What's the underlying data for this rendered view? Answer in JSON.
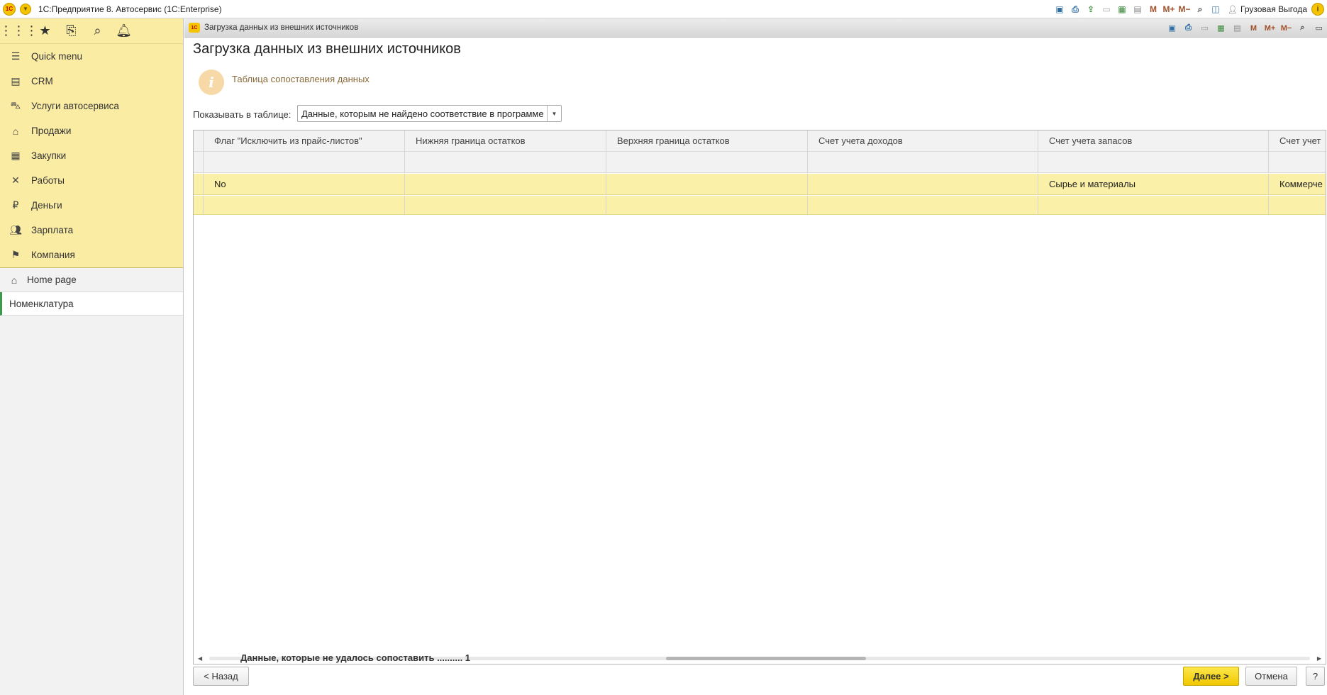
{
  "app": {
    "title": "1С:Предприятие 8. Автосервис  (1С:Enterprise)",
    "user": "Грузовая Выгода"
  },
  "toolbar_icons": [
    "save-icon",
    "print-icon",
    "upload-icon",
    "document-icon",
    "table-icon",
    "calendar-icon",
    "M",
    "M+",
    "M-",
    "zoom-icon",
    "panel-icon"
  ],
  "sidebar": {
    "tools": [
      "apps-grid-icon",
      "star-icon",
      "history-icon",
      "search-icon",
      "bell-icon"
    ],
    "sections": [
      {
        "label": "Quick menu",
        "icon": "menu-icon"
      },
      {
        "label": "CRM",
        "icon": "crm-icon"
      },
      {
        "label": "Услуги автосервиса",
        "icon": "car-icon"
      },
      {
        "label": "Продажи",
        "icon": "shop-icon"
      },
      {
        "label": "Закупки",
        "icon": "cart-icon"
      },
      {
        "label": "Работы",
        "icon": "tools-icon"
      },
      {
        "label": "Деньги",
        "icon": "ruble-icon"
      },
      {
        "label": "Зарплата",
        "icon": "people-icon"
      },
      {
        "label": "Компания",
        "icon": "flag-icon"
      }
    ],
    "home": "Home page",
    "open_item": "Номенклатура"
  },
  "window": {
    "tab_title": "Загрузка данных из внешних источников",
    "page_title": "Загрузка данных из внешних источников",
    "info_text": "Таблица сопоставления данных",
    "filter_label": "Показывать в таблице:",
    "filter_value": "Данные, которым не найдено соответствие в программе"
  },
  "table": {
    "columns": [
      "Флаг \"Исключить из прайс-листов\"",
      "Нижняя граница остатков",
      "Верхняя граница остатков",
      "Счет учета доходов",
      "Счет учета запасов",
      "Счет учет"
    ],
    "rows": [
      [
        "No",
        "",
        "",
        "",
        "Сырье и материалы",
        "Коммерче"
      ],
      [
        "",
        "",
        "",
        "",
        "",
        ""
      ]
    ]
  },
  "summary": "Данные, которые не удалось сопоставить .......... 1",
  "buttons": {
    "back": "< Назад",
    "next": "Далее >",
    "cancel": "Отмена",
    "help": "?"
  }
}
